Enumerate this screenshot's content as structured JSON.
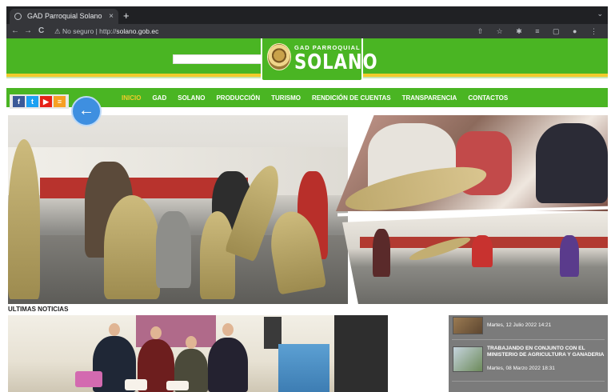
{
  "browser": {
    "tab_title": "GAD Parroquial Solano",
    "tab_close": "×",
    "new_tab": "+",
    "nav_back": "←",
    "nav_forward": "→",
    "nav_reload": "C",
    "security_label": "⚠ No seguro",
    "url_prefix": "http://",
    "url_host": "solano.gob.ec",
    "toolbar_icons": "⇧ ☆ ✱ ≡ ▢ ● ⋮"
  },
  "header": {
    "logo_small": "GAD PARROQUIAL",
    "logo_big": "SOLANO",
    "search_placeholder": ""
  },
  "menu": {
    "items": [
      "INICIO",
      "GAD",
      "SOLANO",
      "PRODUCCIÓN",
      "TURISMO",
      "RENDICIÓN DE CUENTAS",
      "TRANSPARENCIA",
      "CONTACTOS"
    ]
  },
  "social": {
    "facebook": "f",
    "twitter": "t",
    "youtube": "▶",
    "rss": "≡"
  },
  "slider": {
    "back_arrow": "←"
  },
  "news": {
    "section_title": "ULTIMAS NOTICIAS",
    "sidebar": [
      {
        "title": "",
        "date": "Martes, 12 Julio 2022 14:21"
      },
      {
        "title": "TRABAJANDO EN CONJUNTO CON EL MINISTERIO DE AGRICULTURA Y GANADERIA",
        "date": "Martes, 08 Marzo 2022 18:31"
      }
    ]
  },
  "colors": {
    "brand_green": "#4ab523",
    "accent_yellow": "#f2cb2b",
    "sidebar_gray": "#7b7b7b"
  }
}
